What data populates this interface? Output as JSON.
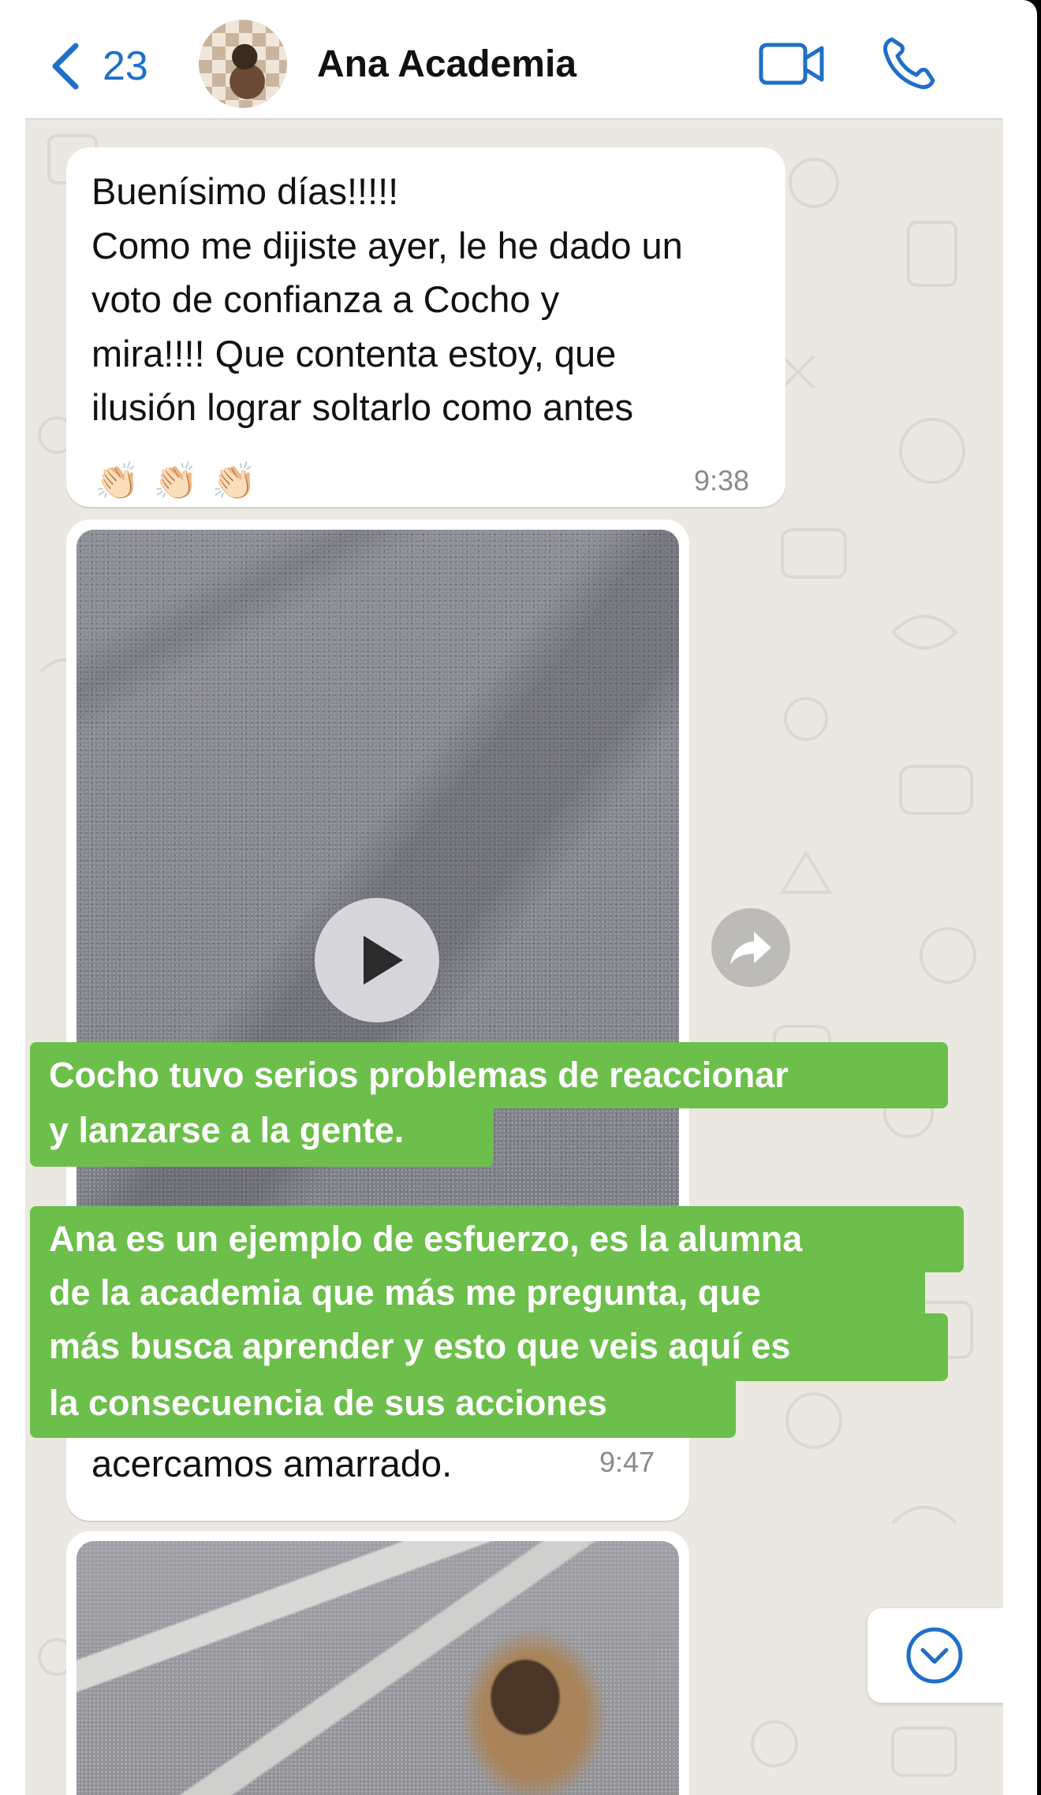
{
  "header": {
    "back_count": "23",
    "contact_name": "Ana Academia"
  },
  "messages": [
    {
      "text": "Buenísimo días!!!!!\nComo me dijiste ayer, le he dado un\nvoto de confianza a Cocho y\nmira!!!! Que contenta estoy, que\nilusión lograr soltarlo como antes",
      "emoji": "👏🏻",
      "time": "9:38"
    },
    {
      "type": "video",
      "tail_text": "acercamos amarrado.",
      "time": "9:47"
    },
    {
      "type": "video"
    }
  ],
  "captions": [
    {
      "lines": [
        "Cocho tuvo serios problemas de reaccionar",
        "y lanzarse a la gente."
      ]
    },
    {
      "lines": [
        "Ana es un ejemplo de esfuerzo, es la alumna",
        "de la academia que más me pregunta, que",
        "más busca aprender y esto que veis aquí es",
        "la consecuencia de sus acciones"
      ]
    }
  ],
  "colors": {
    "accent_blue": "#1f6fc9",
    "caption_green": "#6cbf4a",
    "chat_background": "#ebe8e1"
  },
  "icons": [
    "chevron-left-icon",
    "video-camera-icon",
    "phone-icon",
    "play-icon",
    "forward-share-icon",
    "chevron-down-circle-icon"
  ]
}
